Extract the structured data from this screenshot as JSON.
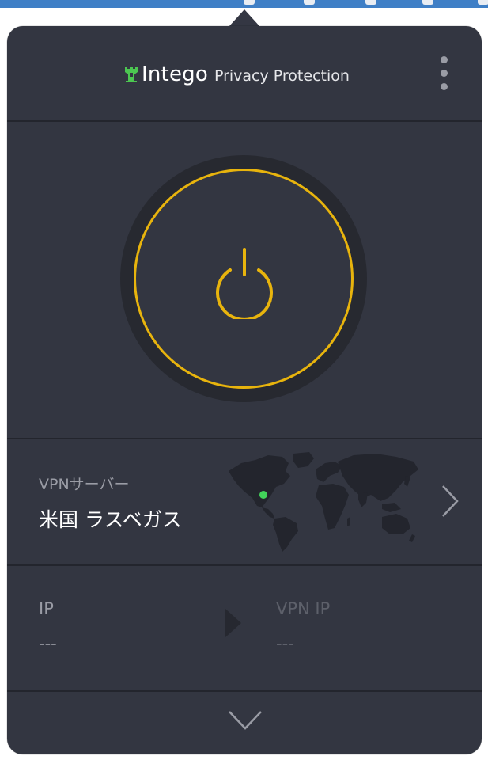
{
  "header": {
    "brand": "Intego",
    "product": "Privacy Protection",
    "menu_icon": "more-vertical-icon",
    "logo_icon": "intego-castle-icon"
  },
  "power": {
    "icon": "power-icon",
    "ring_color": "#e8b40d"
  },
  "server": {
    "label": "VPNサーバー",
    "value": "米国 ラスベガス",
    "map_icon": "world-map-icon",
    "location_dot_color": "#42d35a",
    "chevron_icon": "chevron-right-icon"
  },
  "ip": {
    "label": "IP",
    "value": "---",
    "arrow_icon": "arrow-right-icon",
    "vpn_label": "VPN IP",
    "vpn_value": "---"
  },
  "footer": {
    "expand_icon": "chevron-down-icon"
  },
  "colors": {
    "panel_bg": "#333641",
    "divider": "#23252d",
    "accent_green": "#4cc651",
    "accent_yellow": "#e8b40d",
    "menubar": "#3f7fc6"
  }
}
